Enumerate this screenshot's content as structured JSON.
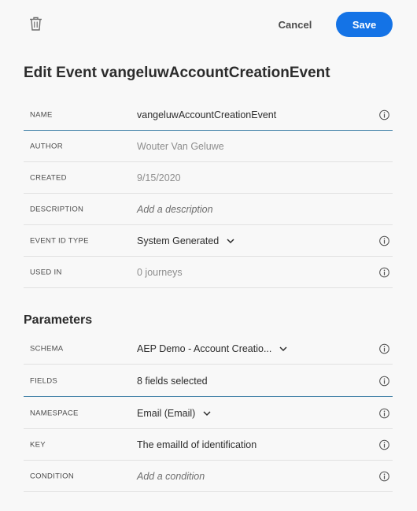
{
  "toolbar": {
    "cancel_label": "Cancel",
    "save_label": "Save"
  },
  "title": "Edit Event vangeluwAccountCreationEvent",
  "event_fields": [
    {
      "label": "NAME",
      "value": "vangeluwAccountCreationEvent"
    },
    {
      "label": "AUTHOR",
      "value": "Wouter Van Geluwe"
    },
    {
      "label": "CREATED",
      "value": "9/15/2020"
    },
    {
      "label": "DESCRIPTION",
      "value": "Add a description"
    },
    {
      "label": "EVENT ID TYPE",
      "value": "System Generated"
    },
    {
      "label": "USED IN",
      "value": "0 journeys"
    }
  ],
  "parameters": {
    "title": "Parameters",
    "fields": [
      {
        "label": "SCHEMA",
        "value": "AEP Demo - Account Creatio..."
      },
      {
        "label": "FIELDS",
        "value": "8 fields selected"
      },
      {
        "label": "NAMESPACE",
        "value": "Email (Email)"
      },
      {
        "label": "KEY",
        "value": "The emailId of identification"
      },
      {
        "label": "CONDITION",
        "value": "Add a condition"
      }
    ]
  },
  "colors": {
    "accent": "#1473e6",
    "background": "#f8f8f8"
  },
  "icons": {
    "delete": "trash-icon",
    "info": "info-icon",
    "dropdown": "chevron-down-icon"
  }
}
